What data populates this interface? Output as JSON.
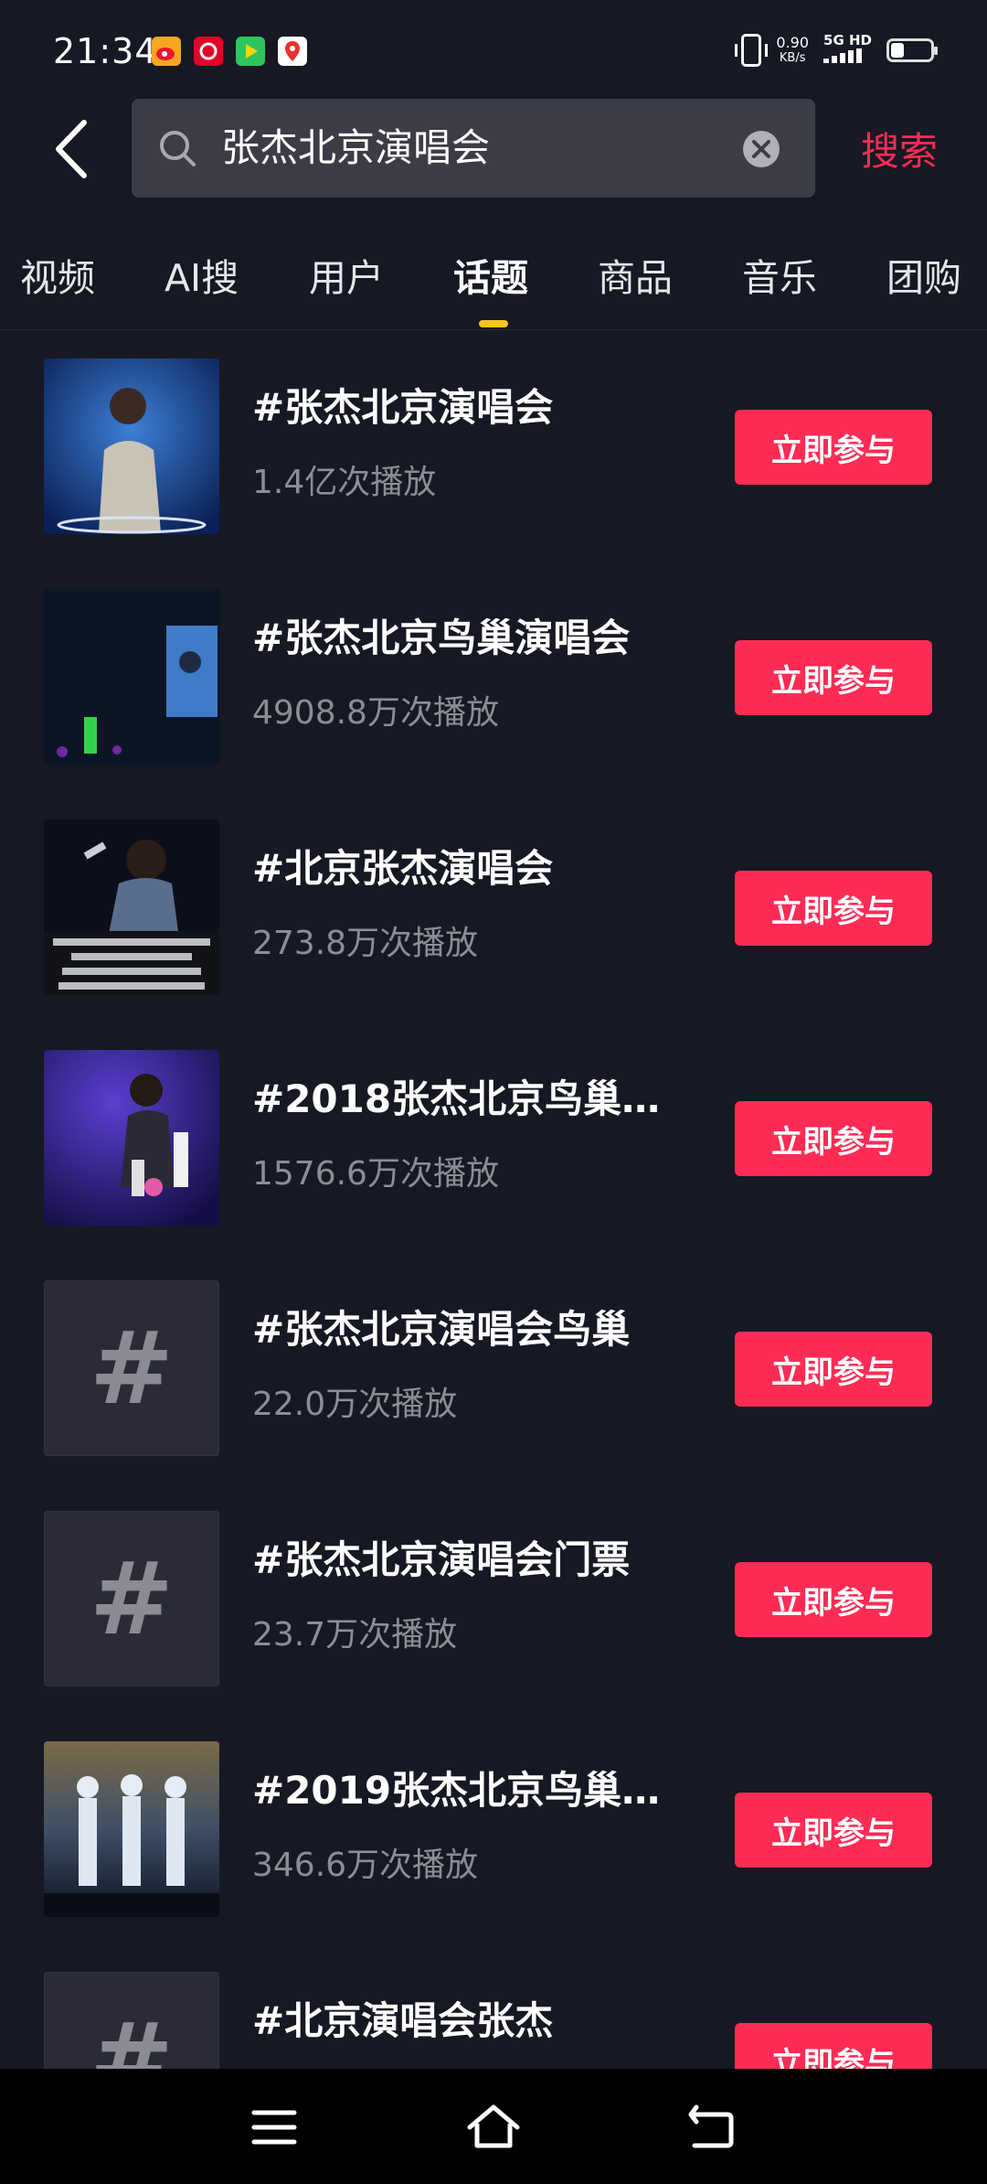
{
  "status_bar": {
    "time": "21:34",
    "speed_value": "0.90",
    "speed_unit": "KB/s",
    "net_top": "5G HD",
    "app_icons": [
      "weibo-icon",
      "netease-music-icon",
      "video-app-icon",
      "map-app-icon"
    ]
  },
  "search": {
    "query": "张杰北京演唱会",
    "button_label": "搜索"
  },
  "tabs": [
    "视频",
    "AI搜",
    "用户",
    "话题",
    "商品",
    "音乐",
    "团购"
  ],
  "active_tab": "话题",
  "join_label": "立即参与",
  "topics": [
    {
      "title": "#张杰北京演唱会",
      "count": "1.4亿次播放",
      "thumb": "photo"
    },
    {
      "title": "#张杰北京鸟巢演唱会",
      "count": "4908.8万次播放",
      "thumb": "photo"
    },
    {
      "title": "#北京张杰演唱会",
      "count": "273.8万次播放",
      "thumb": "photo"
    },
    {
      "title": "#2018张杰北京鸟巢…",
      "count": "1576.6万次播放",
      "thumb": "photo"
    },
    {
      "title": "#张杰北京演唱会鸟巢",
      "count": "22.0万次播放",
      "thumb": "hash"
    },
    {
      "title": "#张杰北京演唱会门票",
      "count": "23.7万次播放",
      "thumb": "hash"
    },
    {
      "title": "#2019张杰北京鸟巢…",
      "count": "346.6万次播放",
      "thumb": "photo"
    },
    {
      "title": "#北京演唱会张杰",
      "count": "",
      "thumb": "hash"
    }
  ],
  "colors": {
    "background": "#161823",
    "accent": "#fe2c55",
    "tab_indicator": "#f5c518",
    "secondary_text": "#8c8d95"
  }
}
